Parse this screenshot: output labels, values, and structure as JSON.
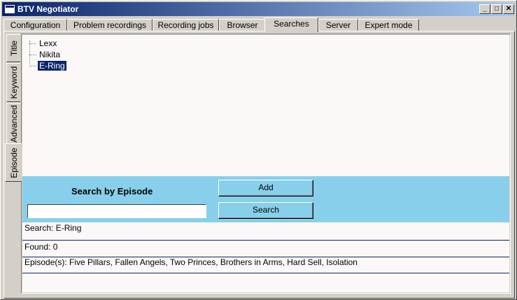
{
  "window": {
    "title": "BTV Negotiator",
    "controls": {
      "minimize": "_",
      "maximize": "□",
      "close": "✕"
    }
  },
  "top_tabs": [
    {
      "label": "Configuration"
    },
    {
      "label": "Problem recordings"
    },
    {
      "label": "Recording jobs"
    },
    {
      "label": "Browser"
    },
    {
      "label": "Searches",
      "active": true
    },
    {
      "label": "Server"
    },
    {
      "label": "Expert mode"
    }
  ],
  "side_tabs": [
    {
      "label": "Title"
    },
    {
      "label": "Keyword"
    },
    {
      "label": "Advanced"
    },
    {
      "label": "Episode",
      "active": true
    }
  ],
  "tree": {
    "items": [
      {
        "label": "Lexx"
      },
      {
        "label": "Nikita"
      },
      {
        "label": "E-Ring",
        "selected": true
      }
    ]
  },
  "search_panel": {
    "heading": "Search by Episode",
    "input_value": "",
    "add_label": "Add",
    "search_label": "Search",
    "background": "#87cfeb"
  },
  "results": {
    "search_line": "Search: E-Ring",
    "found_line": "Found: 0",
    "episodes_line": "Episode(s): Five Pillars,  Fallen Angels,  Two Princes,  Brothers in Arms,  Hard Sell,  Isolation",
    "empty_line": ""
  }
}
